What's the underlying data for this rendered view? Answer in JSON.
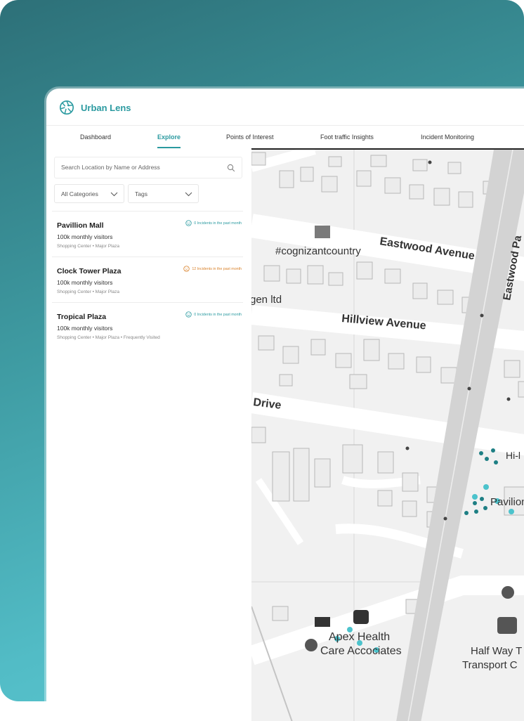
{
  "app": {
    "name": "Urban Lens",
    "accent_color": "#2b9aa0",
    "warning_color": "#d9822b",
    "logo_icon": "aperture-icon"
  },
  "nav": {
    "tabs": [
      {
        "label": "Dashboard",
        "active": false
      },
      {
        "label": "Explore",
        "active": true
      },
      {
        "label": "Points of Interest",
        "active": false
      },
      {
        "label": "Foot traffic Insights",
        "active": false
      },
      {
        "label": "Incident Monitoring",
        "active": false
      }
    ]
  },
  "search": {
    "placeholder": "Search Location by Name or Address",
    "icon": "search-icon"
  },
  "filters": {
    "category": "All Categories",
    "tags": "Tags"
  },
  "places": [
    {
      "name": "Pavillion Mall",
      "visitors": "100k monthly visitors",
      "tags": "Shopping Center • Major Plaza",
      "incidents": "0 Incidents in the past month",
      "status": "ok"
    },
    {
      "name": "Clock Tower Plaza",
      "visitors": "100k monthly visitors",
      "tags": "Shopping Center • Major Plaza",
      "incidents": "12 Incidents in the past month",
      "status": "warning"
    },
    {
      "name": "Tropical Plaza",
      "visitors": "100k monthly visitors",
      "tags": "Shopping Center • Major Plaza  •  Frequently Visited",
      "incidents": "0 Incidents in the past month",
      "status": "ok"
    }
  ],
  "map": {
    "labels": {
      "cognizant": "#cognizantcountry",
      "eastwood_avenue": "Eastwood Avenue",
      "eastwood_park": "Eastwood Pa",
      "gen_ltd": "gen ltd",
      "hillview_avenue": "Hillview Avenue",
      "drive": "Drive",
      "hi": "Hi-l",
      "pavilion": "Pavilion M",
      "apex_line1": "Apex Health",
      "apex_line2": "Care Accociates",
      "halfway_line1": "Half Way T",
      "halfway_line2": "Transport C"
    }
  }
}
